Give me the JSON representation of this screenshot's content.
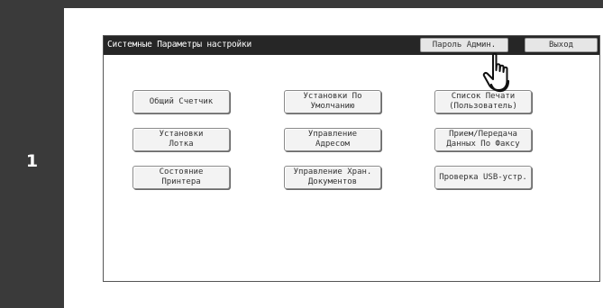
{
  "step": {
    "number": "1"
  },
  "screen": {
    "title": "Системные Параметры настройки",
    "admin_password_button": "Пароль Админ.",
    "exit_button": "Выход",
    "menu": [
      {
        "label": "Общий Счетчик"
      },
      {
        "label": "Установки По\nУмолчанию"
      },
      {
        "label": "Список Печати\n(Пользователь)"
      },
      {
        "label": "Установки\nЛотка"
      },
      {
        "label": "Управление\nАдресом"
      },
      {
        "label": "Прием/Передача\nДанных По Факсу"
      },
      {
        "label": "Состояние\nПринтера"
      },
      {
        "label": "Управление Хран.\nДокументов"
      },
      {
        "label": "Проверка USB-устр."
      }
    ]
  },
  "icons": {
    "pointer": "pointing-hand-icon"
  },
  "colors": {
    "frame": "#3a3a3a",
    "titlebar": "#262626",
    "button_face": "#f3f3f3"
  }
}
